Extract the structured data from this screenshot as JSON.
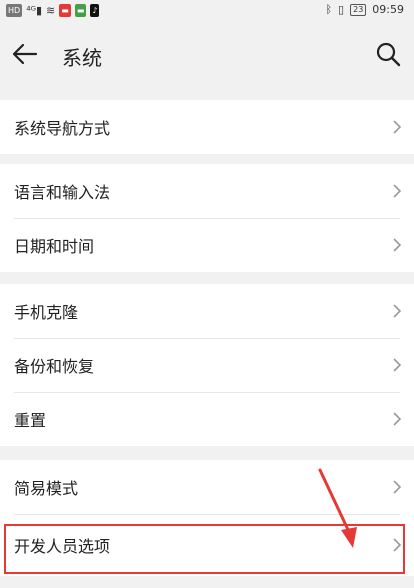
{
  "status_bar": {
    "left_icons": [
      "HD",
      "4G",
      "wifi",
      "app-red",
      "app-green",
      "tiktok"
    ],
    "battery": "23",
    "time": "09:59"
  },
  "header": {
    "title": "系统"
  },
  "groups": [
    {
      "items": [
        {
          "label": "系统导航方式"
        }
      ]
    },
    {
      "items": [
        {
          "label": "语言和输入法"
        },
        {
          "label": "日期和时间"
        }
      ]
    },
    {
      "items": [
        {
          "label": "手机克隆"
        },
        {
          "label": "备份和恢复"
        },
        {
          "label": "重置"
        }
      ]
    },
    {
      "items": [
        {
          "label": "简易模式"
        },
        {
          "label": "开发人员选项"
        }
      ]
    }
  ],
  "colors": {
    "highlight": "#e53935",
    "background": "#f1f1f1",
    "card": "#ffffff"
  }
}
